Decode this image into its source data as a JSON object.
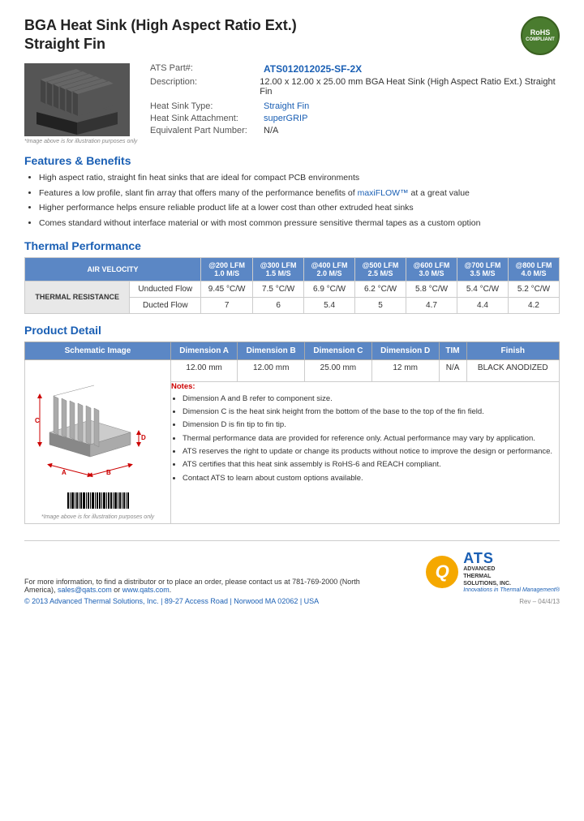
{
  "page": {
    "title_line1": "BGA Heat Sink (High Aspect Ratio Ext.)",
    "title_line2": "Straight Fin",
    "rohs": {
      "line1": "RoHS",
      "line2": "COMPLIANT"
    },
    "image_caption": "*Image above is for illustration purposes only",
    "part_label": "ATS Part#:",
    "part_number": "ATS012012025-SF-2X",
    "description_label": "Description:",
    "description_value": "12.00 x 12.00 x 25.00 mm  BGA Heat Sink (High Aspect Ratio Ext.) Straight Fin",
    "heat_sink_type_label": "Heat Sink Type:",
    "heat_sink_type_value": "Straight Fin",
    "attachment_label": "Heat Sink Attachment:",
    "attachment_value": "superGRIP",
    "equiv_part_label": "Equivalent Part Number:",
    "equiv_part_value": "N/A",
    "features_title": "Features & Benefits",
    "features": [
      "High aspect ratio, straight fin heat sinks that are ideal for compact PCB environments",
      "Features a low profile, slant fin array that offers many of the performance benefits of maxiFLOW™ at a great value",
      "Higher performance helps ensure reliable product life at a lower cost than other extruded heat sinks",
      "Comes standard without interface material or with most common pressure sensitive thermal tapes as a custom option"
    ],
    "thermal_title": "Thermal Performance",
    "thermal_table": {
      "header_row1": [
        "AIR VELOCITY",
        "@200 LFM 1.0 M/S",
        "@300 LFM 1.5 M/S",
        "@400 LFM 2.0 M/S",
        "@500 LFM 2.5 M/S",
        "@600 LFM 3.0 M/S",
        "@700 LFM 3.5 M/S",
        "@800 LFM 4.0 M/S"
      ],
      "row_label": "THERMAL RESISTANCE",
      "sub_rows": [
        {
          "label": "Unducted Flow",
          "values": [
            "9.45 °C/W",
            "7.5 °C/W",
            "6.9 °C/W",
            "6.2 °C/W",
            "5.8 °C/W",
            "5.4 °C/W",
            "5.2 °C/W"
          ]
        },
        {
          "label": "Ducted Flow",
          "values": [
            "7",
            "6",
            "5.4",
            "5",
            "4.7",
            "4.4",
            "4.2"
          ]
        }
      ]
    },
    "product_detail_title": "Product Detail",
    "product_detail_table": {
      "headers": [
        "Schematic Image",
        "Dimension A",
        "Dimension B",
        "Dimension C",
        "Dimension D",
        "TIM",
        "Finish"
      ],
      "dim_values": [
        "12.00 mm",
        "12.00 mm",
        "25.00 mm",
        "12 mm",
        "N/A",
        "BLACK ANODIZED"
      ],
      "schematic_caption": "*Image above is for illustration purposes only"
    },
    "notes": {
      "title": "Notes:",
      "items": [
        "Dimension A and B refer to component size.",
        "Dimension C is the heat sink height from the bottom of the base to the top of the fin field.",
        "Dimension D is fin tip to fin tip.",
        "Thermal performance data are provided for reference only. Actual performance may vary by application.",
        "ATS reserves the right to update or change its products without notice to improve the design or performance.",
        "ATS certifies that this heat sink assembly is RoHS-6 and REACH compliant.",
        "Contact ATS to learn about custom options available."
      ]
    },
    "footer": {
      "contact_text": "For more information, to find a distributor or to place an order, please contact us at 781-769-2000 (North America),",
      "email": "sales@qats.com",
      "or_text": "or",
      "website": "www.qats.com",
      "copyright": "© 2013 Advanced Thermal Solutions, Inc.  |  89-27 Access Road  |  Norwood MA  02062  |  USA",
      "ats_brand": "ATS",
      "ats_full_line1": "ADVANCED",
      "ats_full_line2": "THERMAL",
      "ats_full_line3": "SOLUTIONS, INC.",
      "ats_tagline": "Innovations in Thermal Management®",
      "page_num": "Rev – 04/4/13"
    }
  }
}
